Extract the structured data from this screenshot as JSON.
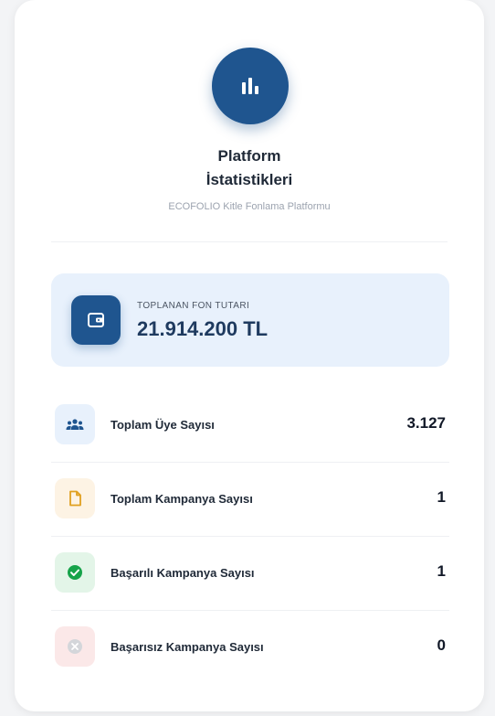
{
  "header": {
    "title_line1": "Platform",
    "title_line2": "İstatistikleri",
    "subtitle": "ECOFOLIO Kitle Fonlama Platformu",
    "icon": "bar-chart-icon"
  },
  "fund": {
    "label": "TOPLANAN FON TUTARI",
    "value": "21.914.200 TL",
    "icon": "wallet-icon"
  },
  "stats": [
    {
      "label": "Toplam Üye Sayısı",
      "value": "3.127",
      "icon": "users-icon",
      "bg": "#e8f1fc",
      "fg": "#1f558f"
    },
    {
      "label": "Toplam Kampanya Sayısı",
      "value": "1",
      "icon": "document-icon",
      "bg": "#fdf3e4",
      "fg": "#e0a020"
    },
    {
      "label": "Başarılı Kampanya Sayısı",
      "value": "1",
      "icon": "check-circle-icon",
      "bg": "#e3f5e8",
      "fg": "#16a34a"
    },
    {
      "label": "Başarısız Kampanya Sayısı",
      "value": "0",
      "icon": "x-circle-icon",
      "bg": "#fbe8e8",
      "fg": "#d1d5db"
    }
  ],
  "colors": {
    "primary": "#1f558f",
    "fund_bg": "#e8f1fc"
  }
}
